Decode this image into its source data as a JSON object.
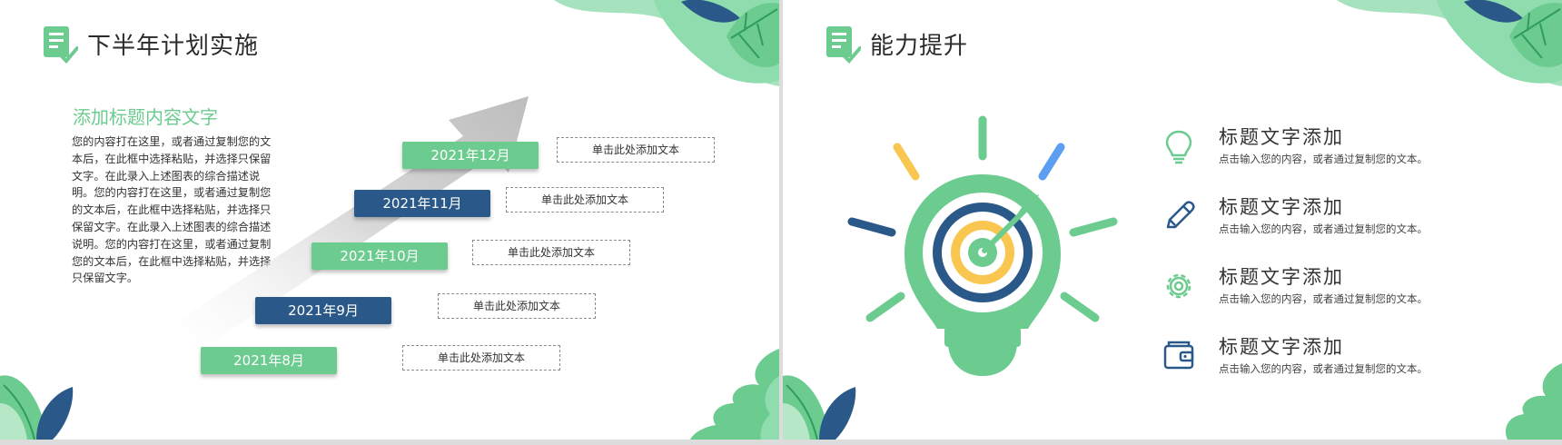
{
  "colors": {
    "green": "#6ccb8f",
    "blue": "#2a5989",
    "yellow": "#f9c74f",
    "light_blue": "#5b9ef2"
  },
  "slide1": {
    "title": "下半年计划实施",
    "title_icon": "checklist-icon",
    "subheading": "添加标题内容文字",
    "body": "您的内容打在这里，或者通过复制您的文本后，在此框中选择粘贴，并选择只保留文字。在此录入上述图表的综合描述说明。您的内容打在这里，或者通过复制您的文本后，在此框中选择粘贴，并选择只保留文字。在此录入上述图表的综合描述说明。您的内容打在这里，或者通过复制您的文本后，在此框中选择粘贴，并选择只保留文字。",
    "timeline": [
      {
        "date": "2021年12月",
        "text": "单击此处添加文本",
        "color": "green"
      },
      {
        "date": "2021年11月",
        "text": "单击此处添加文本",
        "color": "blue"
      },
      {
        "date": "2021年10月",
        "text": "单击此处添加文本",
        "color": "green"
      },
      {
        "date": "2021年9月",
        "text": "单击此处添加文本",
        "color": "blue"
      },
      {
        "date": "2021年8月",
        "text": "单击此处添加文本",
        "color": "green"
      }
    ]
  },
  "slide2": {
    "title": "能力提升",
    "title_icon": "checklist-icon",
    "illustration": "lightbulb-target-icon",
    "features": [
      {
        "icon": "lightbulb-icon",
        "title": "标题文字添加",
        "desc": "点击输入您的内容，或者通过复制您的文本。"
      },
      {
        "icon": "pencil-icon",
        "title": "标题文字添加",
        "desc": "点击输入您的内容，或者通过复制您的文本。"
      },
      {
        "icon": "gear-icon",
        "title": "标题文字添加",
        "desc": "点击输入您的内容，或者通过复制您的文本。"
      },
      {
        "icon": "wallet-icon",
        "title": "标题文字添加",
        "desc": "点击输入您的内容，或者通过复制您的文本。"
      }
    ]
  }
}
